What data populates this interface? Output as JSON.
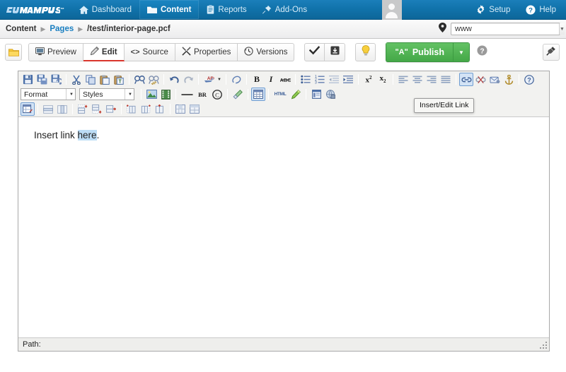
{
  "topnav": {
    "brand": "OUCampus",
    "brand_mark": "ou-campus-logo",
    "trademark": "™",
    "items": [
      {
        "label": "Dashboard",
        "icon": "home-icon",
        "active": false
      },
      {
        "label": "Content",
        "icon": "folder-icon",
        "active": true
      },
      {
        "label": "Reports",
        "icon": "clipboard-icon",
        "active": false
      },
      {
        "label": "Add-Ons",
        "icon": "pin-icon",
        "active": false
      }
    ],
    "avatar": "user-avatar",
    "right_items": [
      {
        "label": "Setup",
        "icon": "gear-icon"
      },
      {
        "label": "Help",
        "icon": "question-circle-icon"
      }
    ]
  },
  "breadcrumb": {
    "items": [
      {
        "label": "Content",
        "is_link": false
      },
      {
        "label": "Pages",
        "is_link": true
      },
      {
        "label": "/test/interior-page.pcf",
        "is_link": false
      }
    ],
    "separator": "▶",
    "pin_icon": "map-pin-icon",
    "url_value": "www",
    "url_placeholder": "www",
    "dropdown_icon": "chevron-down-icon"
  },
  "actionbar": {
    "folder_button_icon": "folder-icon",
    "tabs": [
      {
        "label": "Preview",
        "icon": "monitor-icon",
        "active": false
      },
      {
        "label": "Edit",
        "icon": "pencil-icon",
        "active": true
      },
      {
        "label": "Source",
        "icon": "code-icon",
        "active": false
      },
      {
        "label": "Properties",
        "icon": "wrench-icon",
        "active": false
      },
      {
        "label": "Versions",
        "icon": "clock-revert-icon",
        "active": false
      }
    ],
    "save_group": [
      {
        "name": "save-check-button",
        "icon": "checkmark-icon"
      },
      {
        "name": "save-as-button",
        "icon": "save-box-icon"
      }
    ],
    "hint_button": {
      "name": "lightbulb-button",
      "icon": "lightbulb-icon"
    },
    "publish": {
      "label": "Publish",
      "icon": "broadcast-icon",
      "dropdown_icon": "caret-down-icon"
    },
    "help_icon": "question-circle-icon",
    "plugin_button_icon": "plug-icon"
  },
  "editor": {
    "toolbar_row1": [
      {
        "name": "save-icon",
        "glyph": "save",
        "sep_after": false
      },
      {
        "name": "save-all-icon",
        "glyph": "saveall",
        "sep_after": false
      },
      {
        "name": "save-as-icon",
        "glyph": "saveas",
        "sep_after": true
      },
      {
        "name": "cut-icon",
        "glyph": "cut",
        "sep_after": false
      },
      {
        "name": "copy-icon",
        "glyph": "copy",
        "sep_after": false
      },
      {
        "name": "paste-icon",
        "glyph": "paste",
        "sep_after": false
      },
      {
        "name": "paste-text-icon",
        "glyph": "pastetext",
        "sep_after": true
      },
      {
        "name": "find-icon",
        "glyph": "find",
        "sep_after": false
      },
      {
        "name": "replace-icon",
        "glyph": "replace",
        "sep_after": true
      },
      {
        "name": "undo-icon",
        "glyph": "undo",
        "sep_after": false
      },
      {
        "name": "redo-icon",
        "glyph": "redo",
        "sep_after": true
      },
      {
        "name": "spellcheck-icon",
        "glyph": "spell",
        "sep_after": false
      },
      {
        "name": "spellcheck-dropdown-icon",
        "glyph": "caret",
        "sep_after": true
      },
      {
        "name": "remove-format-icon",
        "glyph": "eraser",
        "sep_after": true
      },
      {
        "name": "bold-icon",
        "glyph": "B",
        "sep_after": false
      },
      {
        "name": "italic-icon",
        "glyph": "I",
        "sep_after": false
      },
      {
        "name": "strikethrough-icon",
        "glyph": "abc",
        "sep_after": true
      },
      {
        "name": "bullet-list-icon",
        "glyph": "ul",
        "sep_after": false
      },
      {
        "name": "numbered-list-icon",
        "glyph": "ol",
        "sep_after": false
      },
      {
        "name": "outdent-icon",
        "glyph": "outdent",
        "sep_after": false
      },
      {
        "name": "indent-icon",
        "glyph": "indent",
        "sep_after": true
      },
      {
        "name": "superscript-icon",
        "glyph": "sup",
        "sep_after": false
      },
      {
        "name": "subscript-icon",
        "glyph": "sub",
        "sep_after": true
      },
      {
        "name": "align-left-icon",
        "glyph": "alignleft",
        "sep_after": false
      },
      {
        "name": "align-center-icon",
        "glyph": "aligncenter",
        "sep_after": false
      },
      {
        "name": "align-right-icon",
        "glyph": "alignright",
        "sep_after": false
      },
      {
        "name": "align-justify-icon",
        "glyph": "alignjustify",
        "sep_after": true
      },
      {
        "name": "insert-link-icon",
        "glyph": "link",
        "selected": true,
        "sep_after": false
      },
      {
        "name": "unlink-icon",
        "glyph": "unlink",
        "sep_after": false
      },
      {
        "name": "insert-mailto-icon",
        "glyph": "mailto",
        "sep_after": false
      },
      {
        "name": "anchor-icon",
        "glyph": "anchor",
        "sep_after": true
      },
      {
        "name": "help-icon",
        "glyph": "help",
        "sep_after": false
      }
    ],
    "format_select": {
      "label": "Format",
      "caret": "▼"
    },
    "styles_select": {
      "label": "Styles",
      "caret": "▼"
    },
    "toolbar_row2": [
      {
        "name": "insert-image-icon",
        "glyph": "image",
        "sep_after": false
      },
      {
        "name": "insert-media-icon",
        "glyph": "media",
        "sep_after": true
      },
      {
        "name": "horizontal-rule-icon",
        "glyph": "hr",
        "sep_after": false
      },
      {
        "name": "line-break-icon",
        "glyph": "BR",
        "sep_after": false
      },
      {
        "name": "copyright-icon",
        "glyph": "copyright",
        "sep_after": true
      },
      {
        "name": "cleanup-icon",
        "glyph": "broom",
        "sep_after": true
      },
      {
        "name": "insert-table-icon",
        "glyph": "table",
        "selected": true,
        "sep_after": true
      },
      {
        "name": "edit-html-icon",
        "glyph": "HTML",
        "sep_after": false
      },
      {
        "name": "edit-source-icon",
        "glyph": "pencilgreen",
        "sep_after": true
      },
      {
        "name": "insert-snippet-icon",
        "glyph": "snippet",
        "sep_after": false
      },
      {
        "name": "insert-asset-icon",
        "glyph": "asset",
        "sep_after": false
      }
    ],
    "toolbar_row3": [
      {
        "name": "table-properties-icon",
        "glyph": "tableprops",
        "selected": true,
        "sep_after": true
      },
      {
        "name": "row-properties-icon",
        "glyph": "rowprops",
        "sep_after": false
      },
      {
        "name": "cell-properties-icon",
        "glyph": "cellprops",
        "sep_after": true
      },
      {
        "name": "insert-row-before-icon",
        "glyph": "rowbefore",
        "sep_after": false
      },
      {
        "name": "insert-row-after-icon",
        "glyph": "rowafter",
        "sep_after": false
      },
      {
        "name": "delete-row-icon",
        "glyph": "delrow",
        "sep_after": true
      },
      {
        "name": "insert-column-before-icon",
        "glyph": "colbefore",
        "sep_after": false
      },
      {
        "name": "insert-column-after-icon",
        "glyph": "colafter",
        "sep_after": false
      },
      {
        "name": "delete-column-icon",
        "glyph": "delcol",
        "sep_after": true
      },
      {
        "name": "merge-cells-icon",
        "glyph": "merge",
        "sep_after": false
      },
      {
        "name": "split-cells-icon",
        "glyph": "split",
        "sep_after": false
      }
    ],
    "content_before": "Insert link ",
    "content_selected": "here",
    "content_after": ".",
    "path_label": "Path:",
    "path_value": "",
    "resize_grip": "resize-grip"
  },
  "tooltip": {
    "text": "Insert/Edit Link"
  },
  "colors": {
    "nav_blue": "#1173ab",
    "accent_link": "#1a7fc1",
    "active_tab_underline": "#d9352c",
    "publish_green": "#44a847",
    "selection_blue": "#bcdcf5",
    "folder_yellow": "#f5c83c"
  }
}
